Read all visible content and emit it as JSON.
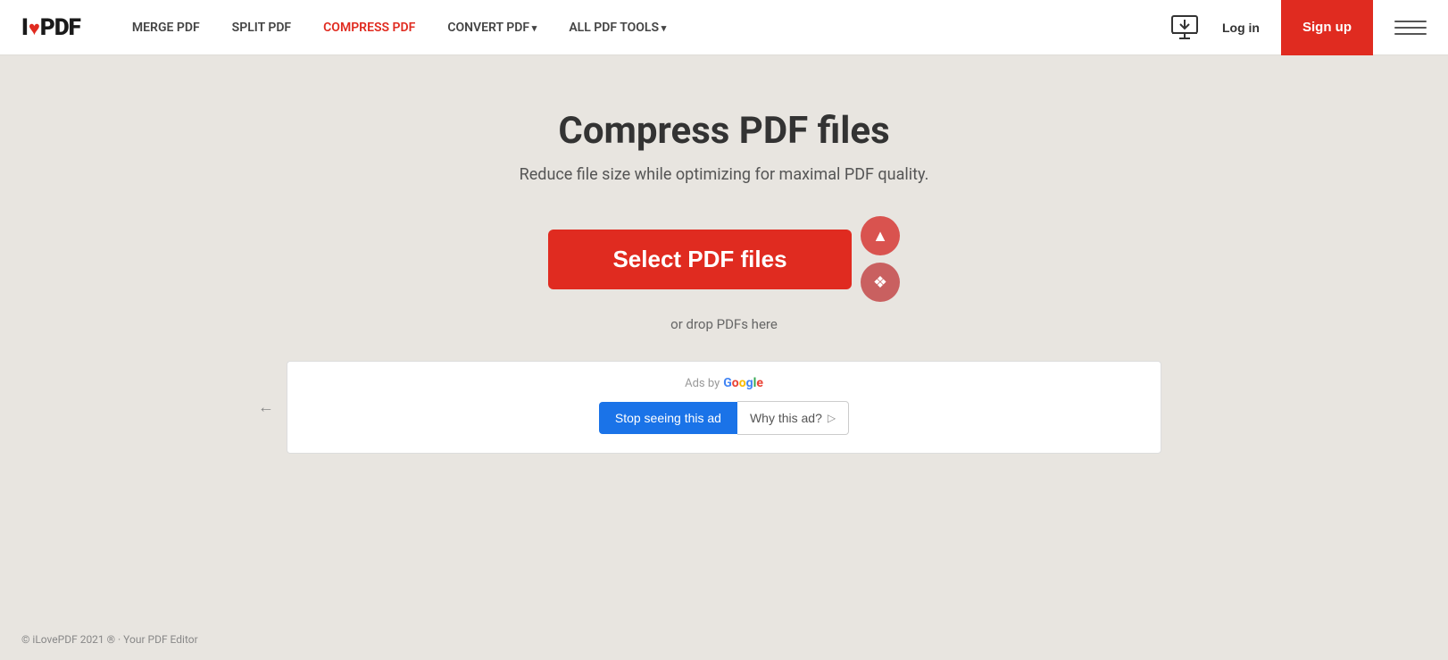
{
  "header": {
    "logo_i": "I",
    "logo_heart": "♥",
    "logo_pdf": "PDF",
    "nav": [
      {
        "id": "merge",
        "label": "MERGE PDF",
        "active": false,
        "hasArrow": false
      },
      {
        "id": "split",
        "label": "SPLIT PDF",
        "active": false,
        "hasArrow": false
      },
      {
        "id": "compress",
        "label": "COMPRESS PDF",
        "active": true,
        "hasArrow": false
      },
      {
        "id": "convert",
        "label": "CONVERT PDF",
        "active": false,
        "hasArrow": true
      },
      {
        "id": "all-tools",
        "label": "ALL PDF TOOLS",
        "active": false,
        "hasArrow": true
      }
    ],
    "login_label": "Log in",
    "signup_label": "Sign up"
  },
  "main": {
    "title": "Compress PDF files",
    "subtitle": "Reduce file size while optimizing for maximal PDF quality.",
    "select_btn_label": "Select PDF files",
    "drop_text": "or drop PDFs here",
    "gdrive_icon": "▲",
    "dropbox_icon": "❖"
  },
  "ads": {
    "ads_by_label": "Ads by",
    "google_label": "Google",
    "stop_ad_label": "Stop seeing this ad",
    "why_ad_label": "Why this ad?"
  },
  "footer": {
    "copyright": "© iLovePDF 2021 ® · Your PDF Editor"
  }
}
